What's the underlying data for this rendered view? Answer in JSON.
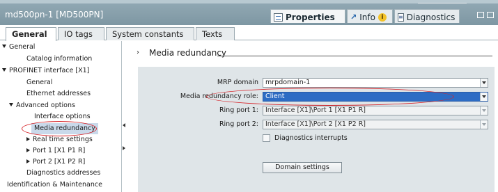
{
  "window": {
    "title": "md500pn-1 [MD500PN]"
  },
  "inspector_tabs": [
    {
      "label": "Properties",
      "icon": "properties-icon",
      "active": true
    },
    {
      "label": "Info",
      "icon": "info-icon",
      "active": false
    },
    {
      "label": "Diagnostics",
      "icon": "diagnostics-icon",
      "active": false
    }
  ],
  "tabs": [
    {
      "label": "General",
      "active": true
    },
    {
      "label": "IO tags",
      "active": false
    },
    {
      "label": "System constants",
      "active": false
    },
    {
      "label": "Texts",
      "active": false
    }
  ],
  "tree": [
    {
      "label": "General",
      "level": 0,
      "expander": "down"
    },
    {
      "label": "Catalog information",
      "level": 2
    },
    {
      "label": "PROFINET interface [X1]",
      "level": 0,
      "expander": "down"
    },
    {
      "label": "General",
      "level": 2
    },
    {
      "label": "Ethernet addresses",
      "level": 2
    },
    {
      "label": "Advanced options",
      "level": 1,
      "expander": "down"
    },
    {
      "label": "Interface options",
      "level": 3
    },
    {
      "label": "Media redundancy",
      "level": 3,
      "selected": true
    },
    {
      "label": "Real time settings",
      "level": 2,
      "expander": "right"
    },
    {
      "label": "Port 1 [X1 P1 R]",
      "level": 2,
      "expander": "right"
    },
    {
      "label": "Port 2 [X1 P2 R]",
      "level": 2,
      "expander": "right"
    },
    {
      "label": "Diagnostics addresses",
      "level": 2
    },
    {
      "label": "Identification & Maintenance",
      "level": 0
    }
  ],
  "section": {
    "title": "Media redundancy"
  },
  "form": {
    "mrp_domain_label": "MRP domain",
    "mrp_domain_value": "mrpdomain-1",
    "role_label": "Media redundancy role:",
    "role_value": "Client",
    "ring_port1_label": "Ring port 1:",
    "ring_port1_value": "Interface [X1]\\Port 1 [X1 P1 R]",
    "ring_port2_label": "Ring port 2:",
    "ring_port2_value": "Interface [X1]\\Port 2 [X1 P2 R]",
    "diag_interrupts_label": "Diagnostics interrupts",
    "diag_interrupts_checked": false,
    "domain_settings_button": "Domain settings"
  },
  "colors": {
    "title_bar": "#859da9",
    "selection": "#2d6cc4",
    "panel": "#dfe5e8",
    "highlight_ellipse": "#d6252a"
  }
}
